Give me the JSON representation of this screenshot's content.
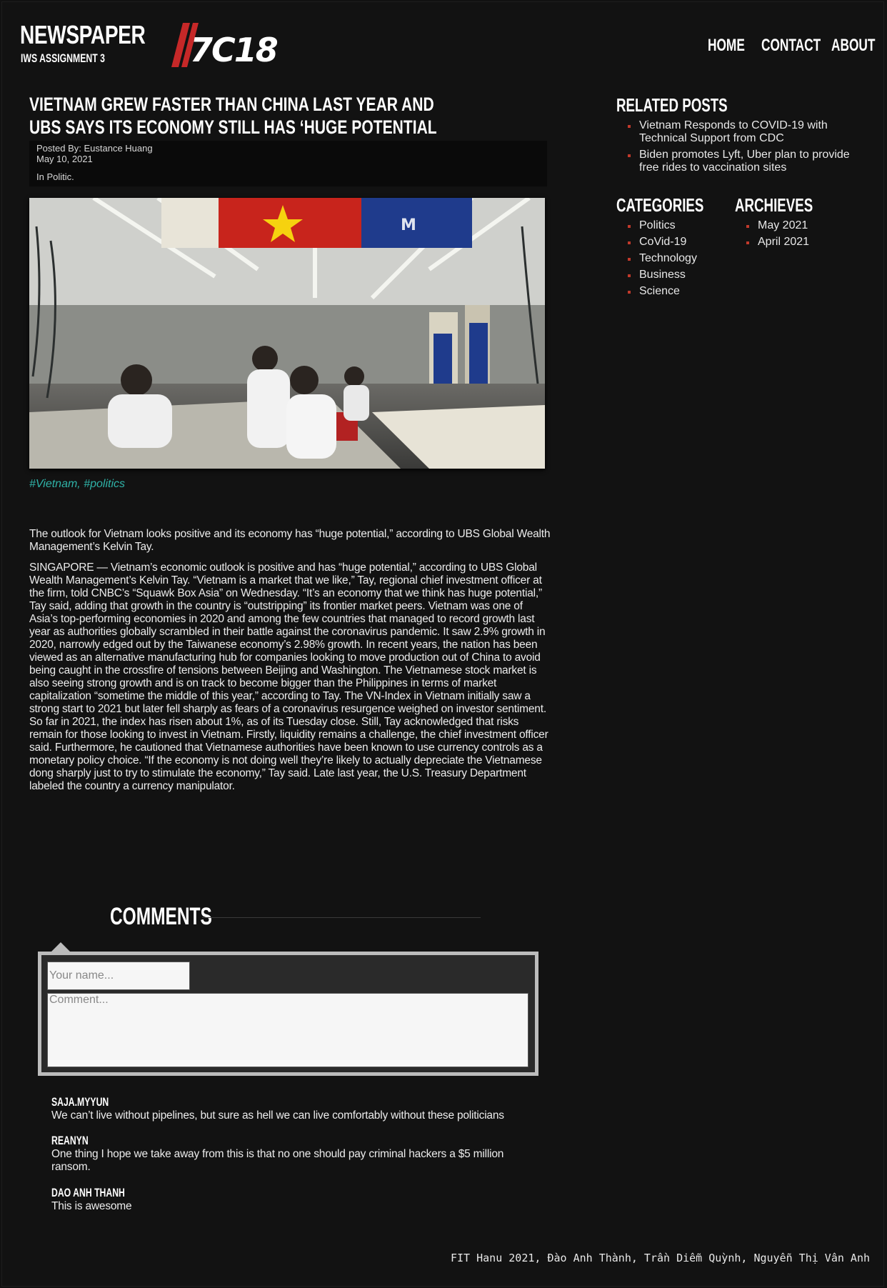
{
  "header": {
    "brand_title": "NEWSPAPER",
    "brand_subtitle": "IWS ASSIGNMENT 3",
    "logo_text": "7C18",
    "nav": [
      "HOME",
      "CONTACT",
      "ABOUT"
    ]
  },
  "article": {
    "title": "VIETNAM GREW FASTER THAN CHINA LAST YEAR AND UBS SAYS ITS ECONOMY STILL HAS ‘HUGE POTENTIAL",
    "posted_by": "Posted By: Eustance Huang",
    "date": "May 10, 2021",
    "category": "In Politic.",
    "tags": "#Vietnam, #politics",
    "lead": "The outlook for Vietnam looks positive and its economy has “huge potential,” according to UBS Global Wealth Management’s Kelvin Tay.",
    "body": "SINGAPORE — Vietnam’s economic outlook is positive and has “huge potential,” according to UBS Global Wealth Management’s Kelvin Tay. “Vietnam is a market that we like,” Tay, regional chief investment officer at the firm, told CNBC’s “Squawk Box Asia” on Wednesday. “It’s an economy that we think has huge potential,” Tay said, adding that growth in the country is “outstripping” its frontier market peers. Vietnam was one of Asia’s top-performing economies in 2020 and among the few countries that managed to record growth last year as authorities globally scrambled in their battle against the coronavirus pandemic. It saw 2.9% growth in 2020, narrowly edged out by the Taiwanese economy’s 2.98% growth. In recent years, the nation has been viewed as an alternative manufacturing hub for companies looking to move production out of China to avoid being caught in the crossfire of tensions between Beijing and Washington. The Vietnamese stock market is also seeing strong growth and is on track to become bigger than the Philippines in terms of market capitalization “sometime the middle of this year,” according to Tay. The VN-Index in Vietnam initially saw a strong start to 2021 but later fell sharply as fears of a coronavirus resurgence weighed on investor sentiment. So far in 2021, the index has risen about 1%, as of its Tuesday close. Still, Tay acknowledged that risks remain for those looking to invest in Vietnam. Firstly, liquidity remains a challenge, the chief investment officer said. Furthermore, he cautioned that Vietnamese authorities have been known to use currency controls as a monetary policy choice. “If the economy is not doing well they’re likely to actually depreciate the Vietnamese dong sharply just to try to stimulate the economy,” Tay said. Late last year, the U.S. Treasury Department labeled the country a currency manipulator."
  },
  "sidebar": {
    "related_title": "RELATED POSTS",
    "related": [
      "Vietnam Responds to COVID-19 with Technical Support from CDC",
      "Biden promotes Lyft, Uber plan to provide free rides to vaccination sites"
    ],
    "categories_title": "CATEGORIES",
    "categories": [
      "Politics",
      "CoVid-19",
      "Technology",
      "Business",
      "Science"
    ],
    "archives_title": "ARCHIEVES",
    "archives": [
      "May 2021",
      "April 2021"
    ]
  },
  "comments": {
    "title": "COMMENTS",
    "name_placeholder": "Your name...",
    "comment_placeholder": "Comment...",
    "items": [
      {
        "author": "SAJA.MYYUN",
        "text": "We can’t live without pipelines, but sure as hell we can live comfortably without these politicians"
      },
      {
        "author": "REANYN",
        "text": "One thing I hope we take away from this is that no one should pay criminal hackers a $5 million ransom."
      },
      {
        "author": "DAO ANH THANH",
        "text": "This is awesome"
      }
    ]
  },
  "footer": {
    "credits": "FIT Hanu 2021, Đào Anh Thành, Trần Diễm Quỳnh, Nguyễn Thị Vân Anh"
  },
  "colors": {
    "background": "#121212",
    "accent_red": "#c0392b",
    "tag_teal": "#2fb3a8"
  }
}
